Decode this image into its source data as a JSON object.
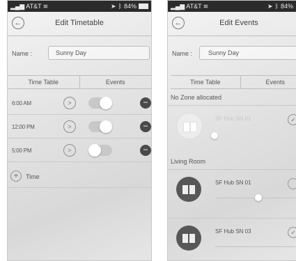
{
  "left": {
    "status": {
      "carrier": "AT&T",
      "battery": "84%"
    },
    "nav": {
      "title": "Edit Timetable"
    },
    "name": {
      "label": "Name :",
      "value": "Sunny Day"
    },
    "tabs": [
      {
        "label": "Time Table",
        "active": true
      },
      {
        "label": "Events",
        "active": false
      }
    ],
    "times": [
      {
        "time": "6:00 AM",
        "enabled": true
      },
      {
        "time": "12:00 PM",
        "enabled": true
      },
      {
        "time": "5:00 PM",
        "enabled": false
      }
    ],
    "add_time_label": "Time"
  },
  "right": {
    "status": {
      "carrier": "AT&T",
      "battery": "84%"
    },
    "nav": {
      "title": "Edit Events"
    },
    "name": {
      "label": "Name :",
      "value": "Sunny Day"
    },
    "tabs": [
      {
        "label": "Time Table",
        "active": true
      },
      {
        "label": "Events",
        "active": false
      }
    ],
    "sections": [
      {
        "title": "No Zone allocated"
      },
      {
        "title": "Living Room"
      }
    ],
    "devices": [
      {
        "name": "SF Hub SN 01",
        "faded": true,
        "checked": true,
        "level": 0.05
      },
      {
        "name": "SF Hub SN 01",
        "faded": false,
        "checked": false,
        "level": 0.55
      },
      {
        "name": "SF Hub SN 03",
        "faded": false,
        "checked": true,
        "level": null
      }
    ]
  },
  "colors": {
    "toggle_track": "#c8c8c8",
    "minus_button": "#4a4a4a",
    "hub_icon": "#575757",
    "statusbar": "#2b2b2b"
  }
}
